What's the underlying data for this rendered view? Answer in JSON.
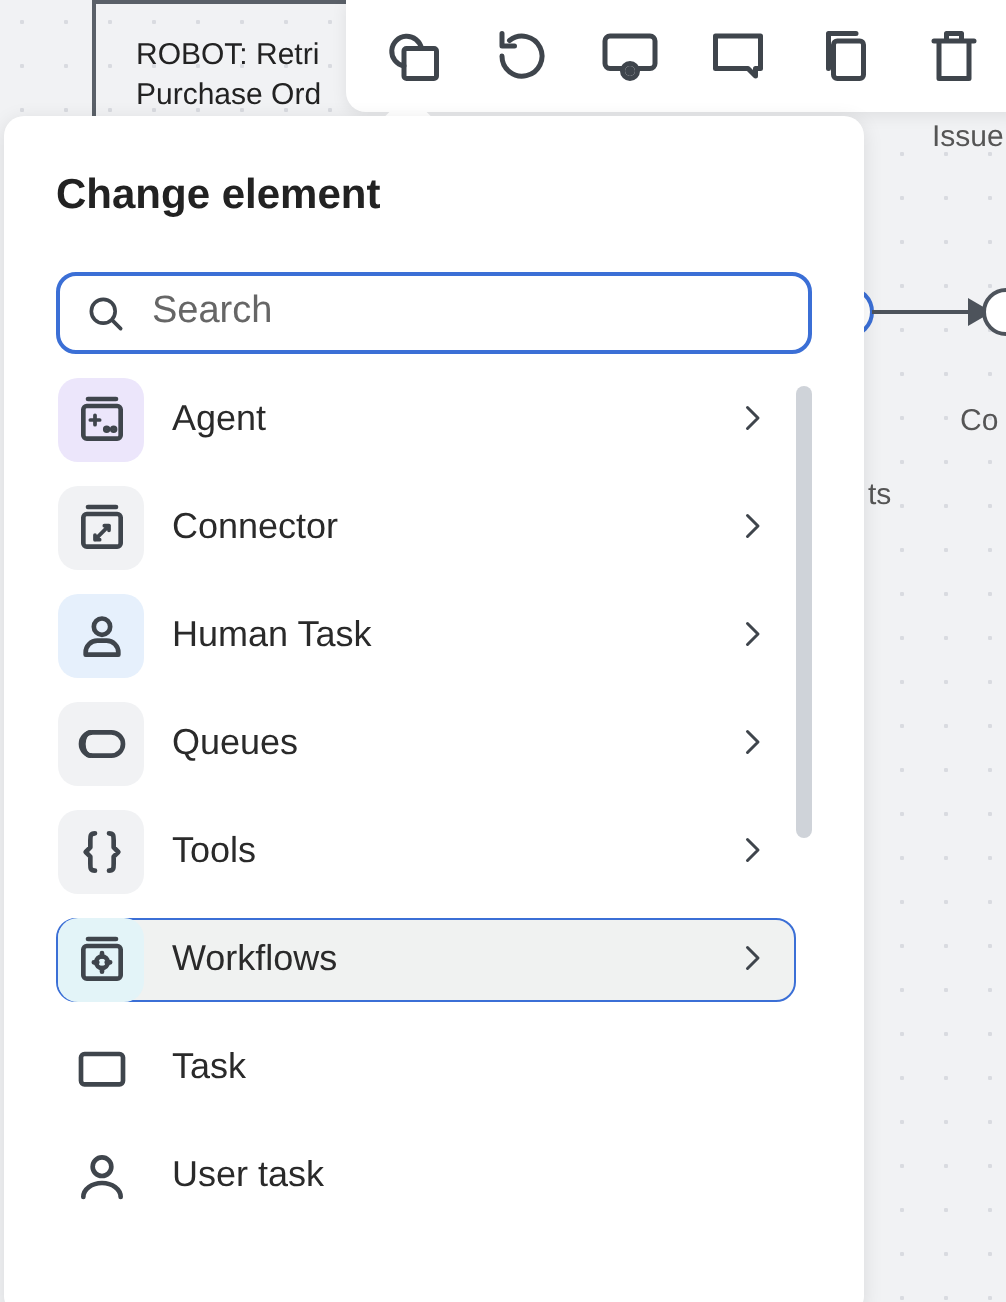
{
  "canvas": {
    "node_lines": [
      "ROBOT: Retri",
      "Purchase Ord"
    ],
    "labels": [
      "Issue",
      "ts",
      "Co"
    ]
  },
  "toolbar": {
    "buttons": [
      {
        "kind": "change"
      },
      {
        "kind": "reset"
      },
      {
        "kind": "preview"
      },
      {
        "kind": "comment"
      },
      {
        "kind": "copy"
      },
      {
        "kind": "delete"
      }
    ]
  },
  "popup": {
    "title": "Change element",
    "search": {
      "placeholder": "Search"
    },
    "items": [
      {
        "kind": "category",
        "label": "Agent",
        "color": "#ece6fb",
        "selected": false
      },
      {
        "kind": "category",
        "label": "Connector",
        "color": "#f1f2f4",
        "selected": false
      },
      {
        "kind": "category",
        "label": "Human Task",
        "color": "#e6f0fc",
        "selected": false
      },
      {
        "kind": "category",
        "label": "Queues",
        "color": "#f1f2f4",
        "selected": false
      },
      {
        "kind": "category",
        "label": "Tools",
        "color": "#f1f2f4",
        "selected": false
      },
      {
        "kind": "category",
        "label": "Workflows",
        "color": "#e3f4f8",
        "selected": true
      },
      {
        "kind": "element",
        "label": "Task",
        "selected": false
      },
      {
        "kind": "element",
        "label": "User task",
        "selected": false
      }
    ]
  }
}
